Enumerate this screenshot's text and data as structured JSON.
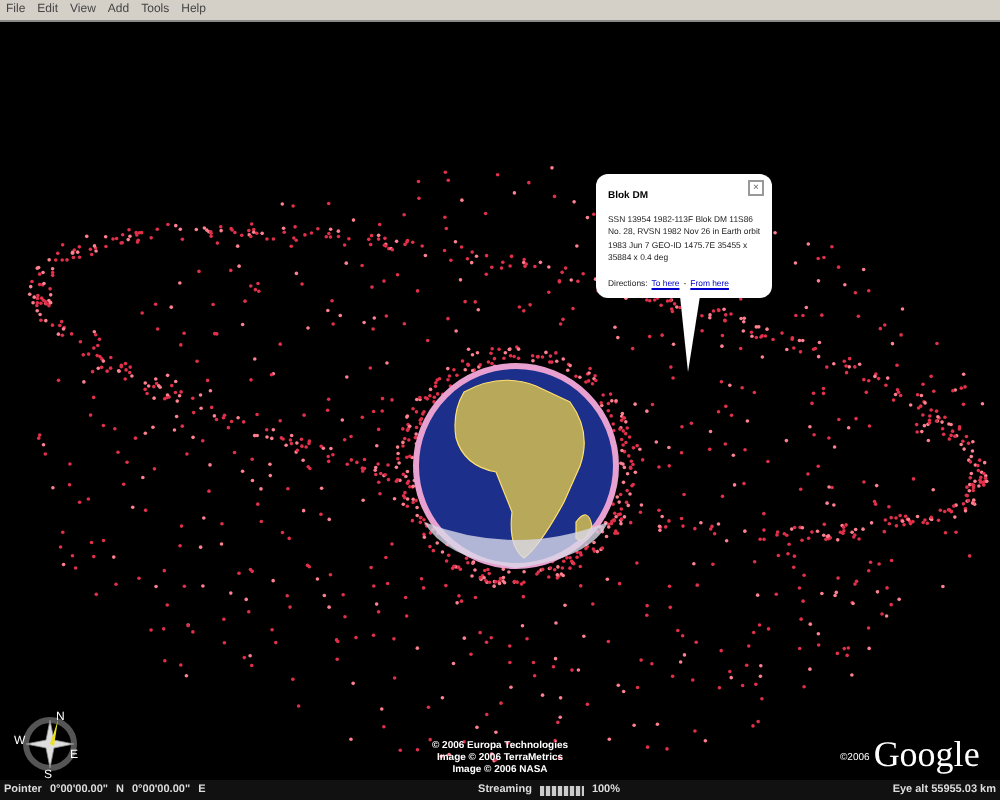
{
  "menu": [
    "File",
    "Edit",
    "View",
    "Add",
    "Tools",
    "Help"
  ],
  "popup": {
    "title": "Blok DM",
    "description": "SSN 13954 1982-113F Blok DM 11S86 No. 28, RVSN 1982 Nov 26 in Earth orbit 1983 Jun 7 GEO-ID 1475.7E 35455 x 35884 x 0.4 deg",
    "directions_label": "Directions:",
    "links": [
      "To here",
      "From here"
    ],
    "separator": "-",
    "close": "×"
  },
  "compass": {
    "north": "N",
    "east": "E",
    "south": "S",
    "west": "W"
  },
  "copyright": [
    "© 2006 Europa Technologies",
    "Image © 2006 TerraMetrics",
    "Image © 2006 NASA"
  ],
  "logo": {
    "year": "©2006",
    "text": "Google"
  },
  "status_bar": {
    "pointer_label": "Pointer",
    "latitude": "0°00'00.00\"",
    "lat_hemisphere": "N",
    "longitude": "0°00'00.00\"",
    "lon_hemisphere": "E",
    "streaming_label": "Streaming",
    "level": 1,
    "percent": "100%",
    "eye_alt": "Eye  alt 55955.03 km"
  }
}
